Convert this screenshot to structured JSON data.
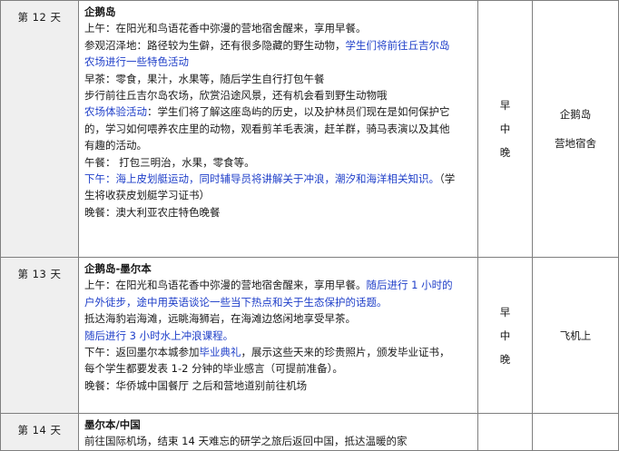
{
  "days": [
    {
      "day": "第 12 天",
      "title": "企鹅岛",
      "lines": [
        [
          {
            "t": "上午：在阳光和鸟语花香中弥漫的营地宿舍醒来，享用早餐。"
          }
        ],
        [
          {
            "t": "参观沼泽地：路径较为生僻，还有很多隐藏的野生动物，"
          },
          {
            "t": "学生们将前往丘吉尔岛",
            "c": "blue"
          }
        ],
        [
          {
            "t": "农场进行一些特色活动",
            "c": "blue"
          }
        ],
        [
          {
            "t": "早茶：零食，果汁，水果等，随后学生自行打包午餐"
          }
        ],
        [
          {
            "t": "步行前往丘吉尔岛农场，欣赏沿途风景，还有机会看到野生动物哦"
          }
        ],
        [
          {
            "t": "农场体验活动",
            "c": "blue"
          },
          {
            "t": "：学生们将了解这座岛屿的历史，以及护林员们现在是如何保护它"
          }
        ],
        [
          {
            "t": "的，学习如何喂养农庄里的动物，观看剪羊毛表演，赶羊群，骑马表演以及其他"
          }
        ],
        [
          {
            "t": "有趣的活动。"
          }
        ],
        [
          {
            "t": "午餐： 打包三明治，水果，零食等。"
          }
        ],
        [
          {
            "t": "下午：海上皮划艇运动，同时辅导员将讲解关于冲浪，潮汐和海洋相关知识。",
            "c": "blue"
          },
          {
            "t": "（学"
          }
        ],
        [
          {
            "t": "生将收获皮划艇学习证书）"
          }
        ],
        [
          {
            "t": "晚餐：澳大利亚农庄特色晚餐"
          }
        ]
      ],
      "meals": [
        "早",
        "中",
        "晚"
      ],
      "hotel": [
        "企鹅岛",
        "营地宿舍"
      ]
    },
    {
      "day": "第 13 天",
      "title": "企鹅岛-墨尔本",
      "lines": [
        [
          {
            "t": "上午：在阳光和鸟语花香中弥漫的营地宿舍醒来，享用早餐。"
          },
          {
            "t": "随后进行 1 小时的",
            "c": "blue"
          }
        ],
        [
          {
            "t": "户外徒步，途中用英语谈论一些当下热点和关于生态保护的话题。",
            "c": "blue"
          }
        ],
        [
          {
            "t": "抵达海豹岩海滩，远眺海狮岩，在海滩边悠闲地享受早茶。"
          }
        ],
        [
          {
            "t": "随后进行 3 小时水上冲浪课程。",
            "c": "blue"
          }
        ],
        [
          {
            "t": "下午：返回墨尔本城参加"
          },
          {
            "t": "毕业典礼",
            "c": "blue"
          },
          {
            "t": "，展示这些天来的珍贵照片，颁发毕业证书，"
          }
        ],
        [
          {
            "t": "每个学生都要发表 1-2 分钟的毕业感言（可提前准备）。"
          }
        ],
        [
          {
            "t": "晚餐：华侨城中国餐厅 之后和营地道别前往机场"
          }
        ]
      ],
      "meals": [
        "早",
        "中",
        "晚"
      ],
      "hotel": [
        "飞机上"
      ]
    },
    {
      "day": "第 14 天",
      "title": "墨尔本/中国",
      "lines": [
        [
          {
            "t": "前往国际机场，结束 14 天难忘的研学之旅后返回中国，抵达温暖的家"
          }
        ]
      ],
      "meals": [],
      "hotel": []
    }
  ],
  "colors": {
    "text": "#1a1a1a",
    "highlight": "#1f3fc9",
    "day_cell_bg": "#efefef",
    "border": "#7f7f7f"
  }
}
